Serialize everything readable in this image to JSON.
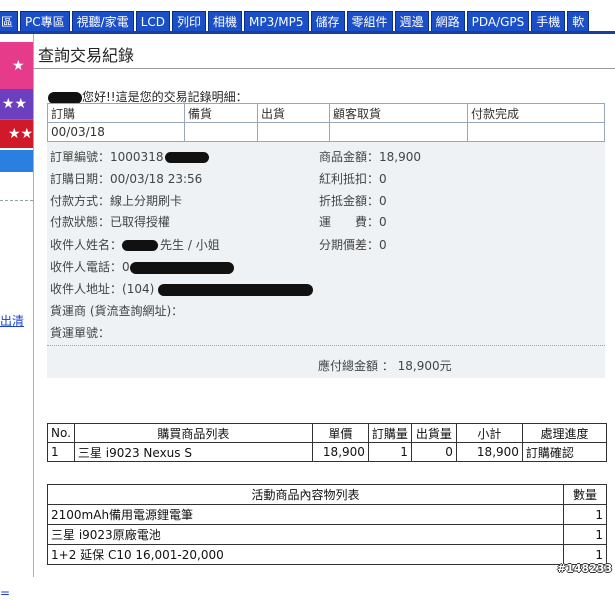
{
  "nav": {
    "tabs": [
      "區",
      "PC專區",
      "視聽/家電",
      "LCD",
      "列印",
      "相機",
      "MP3/MP5",
      "儲存",
      "零組件",
      "週邊",
      "網路",
      "PDA/GPS",
      "手機",
      "軟"
    ]
  },
  "sidebar": {
    "link1": "出清",
    "link2": "="
  },
  "page": {
    "title": "查詢交易紀錄",
    "greeting": "您好!!這是您的交易記錄明細："
  },
  "status_table": {
    "headers": [
      "訂購",
      "備貨",
      "出貨",
      "顧客取貨",
      "付款完成"
    ],
    "values": [
      "00/03/18",
      "",
      "",
      "",
      ""
    ]
  },
  "order": {
    "left": [
      {
        "label": "訂單編號：",
        "value": "1000318"
      },
      {
        "label": "訂購日期：",
        "value": "00/03/18 23:56"
      },
      {
        "label": "付款方式：",
        "value": "線上分期刷卡"
      },
      {
        "label": "付款狀態：",
        "value": "已取得授權"
      },
      {
        "label": "收件人姓名：",
        "value": "先生 / 小姐"
      },
      {
        "label": "收件人電話：",
        "value": "0"
      },
      {
        "label": "收件人地址：",
        "value": "(104)"
      },
      {
        "label": "貨運商 (貨流查詢網址)：",
        "value": ""
      },
      {
        "label": "貨運單號：",
        "value": ""
      }
    ],
    "right": [
      {
        "label": "商品金額：",
        "value": "18,900"
      },
      {
        "label": "紅利抵扣：",
        "value": "0"
      },
      {
        "label": "折抵金額：",
        "value": "0"
      },
      {
        "label": "運　　費：",
        "value": "0"
      },
      {
        "label": "分期價差：",
        "value": "0"
      }
    ],
    "total_label": "應付總金額 ：",
    "total_value": "18,900元"
  },
  "items_table": {
    "headers": [
      "No.",
      "購買商品列表",
      "單價",
      "訂購量",
      "出貨量",
      "小計",
      "處理進度"
    ],
    "rows": [
      [
        "1",
        "三星 i9023 Nexus S",
        "18,900",
        "1",
        "0",
        "18,900",
        "訂購確認"
      ]
    ]
  },
  "promo_table": {
    "headers": [
      "活動商品內容物列表",
      "數量"
    ],
    "rows": [
      [
        "2100mAh備用電源鋰電筆",
        "1"
      ],
      [
        "三星 i9023原廠電池",
        "1"
      ],
      [
        "1+2 延保 C10 16,001-20,000",
        "1"
      ]
    ]
  },
  "watermark": "#148233",
  "colors": {
    "nav_tab": "#1a4fc8",
    "panel_bg": "#eef2f5"
  }
}
